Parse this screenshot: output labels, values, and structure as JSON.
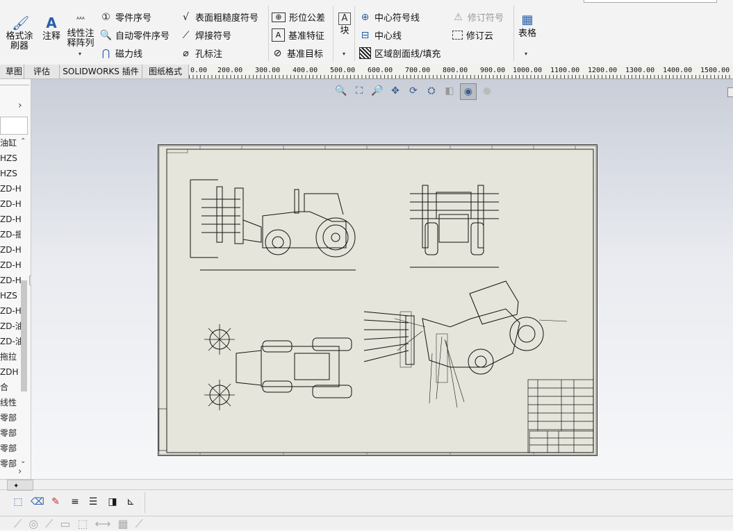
{
  "ribbon": {
    "format_painter": "格式涂刷器",
    "annotation": "注释",
    "linear_pattern": "线性注释阵列",
    "balloon": "零件序号",
    "auto_balloon": "自动零件序号",
    "magnetic_line": "磁力线",
    "surface_finish": "表面粗糙度符号",
    "weld_symbol": "焊接符号",
    "hole_callout": "孔标注",
    "geometric_tolerance": "形位公差",
    "datum_feature": "基准特征",
    "datum_target": "基准目标",
    "block": "块",
    "center_mark": "中心符号线",
    "centerline": "中心线",
    "area_hatch": "区域剖面线/填充",
    "revision_symbol": "修订符号",
    "revision_cloud": "修订云",
    "table": "表格"
  },
  "tabs": [
    "草图",
    "评估",
    "SOLIDWORKS 插件",
    "图纸格式"
  ],
  "ruler_labels": [
    "0.00",
    "200.00",
    "300.00",
    "400.00",
    "500.00",
    "600.00",
    "700.00",
    "800.00",
    "900.00",
    "1000.00",
    "1100.00",
    "1200.00",
    "1300.00",
    "1400.00",
    "1500.00"
  ],
  "tree_items": [
    "油缸",
    "HZS",
    "HZS",
    "ZD-H",
    "ZD-H",
    "ZD-H",
    "ZD-振",
    "ZD-H",
    "ZD-H",
    "ZD-H",
    "HZS",
    "ZD-H",
    "ZD-油",
    "ZD-油",
    "拖拉",
    "ZDH",
    "合",
    "线性",
    "零部",
    "零部",
    "零部",
    "零部"
  ],
  "colors": {
    "ribbon_bg": "#f3f3f3",
    "sheet_bg": "#e5e5dc",
    "canvas_top": "#c9ced8",
    "accent": "#2a5fa8"
  }
}
